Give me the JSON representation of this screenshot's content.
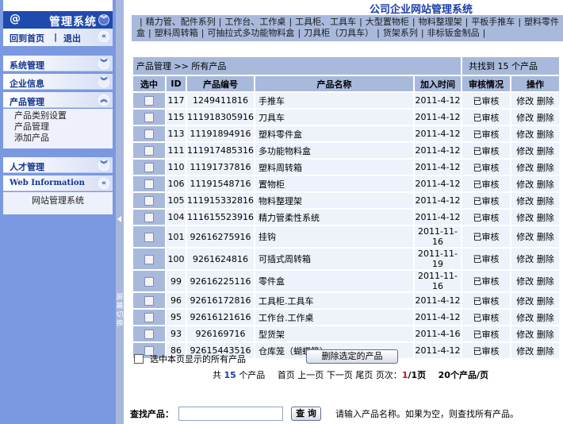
{
  "sidebar": {
    "header": {
      "at_icon": "@",
      "title": "管理系统",
      "toggle_icon": "double-chevron-down"
    },
    "links": {
      "home": "回到首页",
      "divider": "|",
      "logout": "退出",
      "toggle_icon": "double-chevron-left"
    },
    "sections": [
      {
        "label": "系统管理",
        "toggle_icon": "double-chevron-down"
      },
      {
        "label": "企业信息",
        "toggle_icon": "double-chevron-down"
      },
      {
        "label": "产品管理",
        "toggle_icon": "double-chevron-up",
        "items": [
          "产品类别设置",
          "产品管理",
          "添加产品"
        ]
      },
      {
        "label": "人才管理",
        "toggle_icon": "double-chevron-down"
      },
      {
        "label": "Web Information",
        "toggle_icon": "double-chevron-left",
        "items": [
          "网站管理系统"
        ]
      }
    ]
  },
  "splitter": {
    "label": "屏幕切换",
    "arrow_icon": "triangle-left"
  },
  "header": {
    "site_title": "公司企业网站管理系统",
    "nav_categories": [
      "精力管、配件系列",
      "工作台、工作桌",
      "工具柜、工具车",
      "大型置物柜",
      "物料整理架",
      "平板手推车",
      "塑料零件盒",
      "塑料周转箱",
      "可抽拉式多功能物料盒",
      "刀具柜（刀具车）",
      "货架系列",
      "非标钣金制品"
    ]
  },
  "main": {
    "breadcrumb": "产品管理 >> 所有产品",
    "found_text": "共找到 15 个产品",
    "columns": [
      "选中",
      "ID",
      "产品编号",
      "产品名称",
      "加入时间",
      "审核情况",
      "操作"
    ],
    "rows": [
      {
        "id": "117",
        "code": "1249411816",
        "name": "手推车",
        "date": "2011-4-12",
        "status": "已审核",
        "edit": "修改",
        "delete": "删除"
      },
      {
        "id": "115",
        "code": "111918305916",
        "name": "刀具车",
        "date": "2011-4-12",
        "status": "已审核",
        "edit": "修改",
        "delete": "删除"
      },
      {
        "id": "113",
        "code": "11191894916",
        "name": "塑料零件盒",
        "date": "2011-4-12",
        "status": "已审核",
        "edit": "修改",
        "delete": "删除"
      },
      {
        "id": "111",
        "code": "111917485316",
        "name": "多功能物料盒",
        "date": "2011-4-12",
        "status": "已审核",
        "edit": "修改",
        "delete": "删除"
      },
      {
        "id": "110",
        "code": "11191737816",
        "name": "塑料周转箱",
        "date": "2011-4-12",
        "status": "已审核",
        "edit": "修改",
        "delete": "删除"
      },
      {
        "id": "106",
        "code": "11191548716",
        "name": "置物柜",
        "date": "2011-4-12",
        "status": "已审核",
        "edit": "修改",
        "delete": "删除"
      },
      {
        "id": "105",
        "code": "111915332816",
        "name": "物料整理架",
        "date": "2011-4-12",
        "status": "已审核",
        "edit": "修改",
        "delete": "删除"
      },
      {
        "id": "104",
        "code": "111615523916",
        "name": "精力管柔性系统",
        "date": "2011-4-12",
        "status": "已审核",
        "edit": "修改",
        "delete": "删除"
      },
      {
        "id": "101",
        "code": "92616275916",
        "name": "挂钩",
        "date": "2011-11-16",
        "status": "已审核",
        "edit": "修改",
        "delete": "删除"
      },
      {
        "id": "100",
        "code": "9261624816",
        "name": "可插式周转箱",
        "date": "2011-11-19",
        "status": "已审核",
        "edit": "修改",
        "delete": "删除"
      },
      {
        "id": "99",
        "code": "92616225116",
        "name": "零件盒",
        "date": "2011-11-16",
        "status": "已审核",
        "edit": "修改",
        "delete": "删除"
      },
      {
        "id": "96",
        "code": "92616172816",
        "name": "工具柜.工具车",
        "date": "2011-4-12",
        "status": "已审核",
        "edit": "修改",
        "delete": "删除"
      },
      {
        "id": "95",
        "code": "92616121616",
        "name": "工作台.工作桌",
        "date": "2011-4-12",
        "status": "已审核",
        "edit": "修改",
        "delete": "删除"
      },
      {
        "id": "93",
        "code": "926169716",
        "name": "型货架",
        "date": "2011-4-16",
        "status": "已审核",
        "edit": "修改",
        "delete": "删除"
      },
      {
        "id": "86",
        "code": "92615443516",
        "name": "仓库笼（蝴蝶笼）",
        "date": "2011-4-12",
        "status": "已审核",
        "edit": "修改",
        "delete": "删除"
      }
    ],
    "select_all_label": "选中本页显示的所有产品",
    "delete_selected_label": "删除选定的产品",
    "pager": {
      "total_prefix": "共",
      "total": "15",
      "total_suffix": "个产品",
      "first": "首页",
      "prev": "上一页",
      "next": "下一页",
      "last": "尾页",
      "page_label": "页次：",
      "current": "1",
      "of_pages": "/1页",
      "per_page": "20个产品/页"
    },
    "search": {
      "label": "查找产品：",
      "value": "",
      "button": "查 询",
      "hint": "请输入产品名称。如果为空，则查找所有产品。"
    }
  }
}
